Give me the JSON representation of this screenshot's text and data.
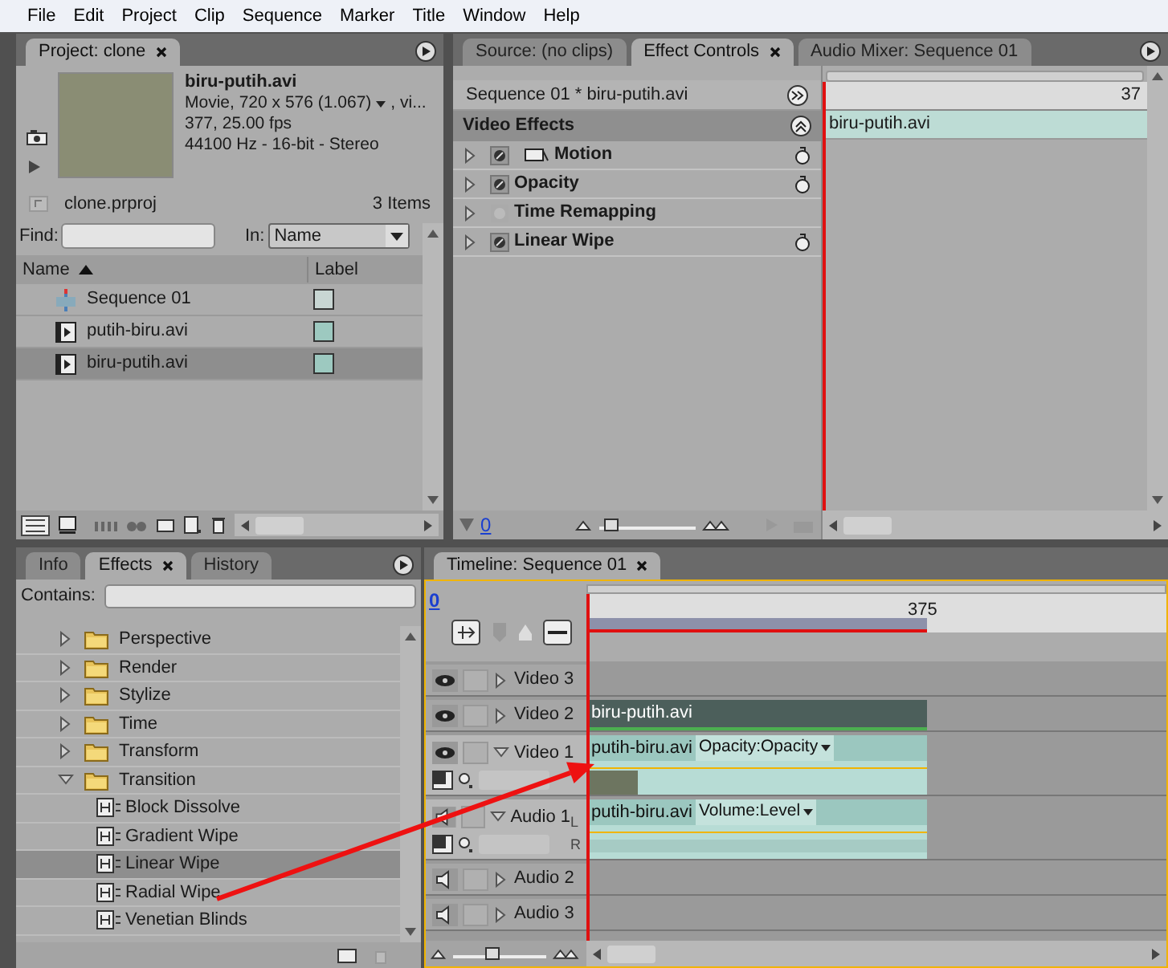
{
  "menu": [
    "File",
    "Edit",
    "Project",
    "Clip",
    "Sequence",
    "Marker",
    "Title",
    "Window",
    "Help"
  ],
  "project": {
    "tabs": [
      {
        "label": "Project: clone",
        "selected": true
      }
    ],
    "clip": {
      "name": "biru-putih.avi",
      "format": "Movie, 720 x 576 (1.067)",
      "format_more": ", vi...",
      "frames": "377, 25.00 fps",
      "audio": "44100 Hz - 16-bit - Stereo"
    },
    "file": "clone.prproj",
    "count": "3 Items",
    "find_label": "Find:",
    "in_label": "In:",
    "in_value": "Name",
    "columns": [
      "Name",
      "Label"
    ],
    "items": [
      {
        "name": "Sequence 01",
        "kind": "sequence",
        "color": "#c8d6d3",
        "selected": false
      },
      {
        "name": "putih-biru.avi",
        "kind": "clip",
        "color": "#9dc9c0",
        "selected": false
      },
      {
        "name": "biru-putih.avi",
        "kind": "clip",
        "color": "#9dc9c0",
        "selected": true
      }
    ]
  },
  "effect_controls": {
    "tabs": [
      {
        "label": "Source: (no clips)",
        "selected": false
      },
      {
        "label": "Effect Controls",
        "selected": true
      },
      {
        "label": "Audio Mixer: Sequence 01",
        "selected": false
      }
    ],
    "header": "Sequence 01 * biru-putih.avi",
    "section": "Video Effects",
    "effects": [
      {
        "name": "Motion",
        "toggle_enabled": true,
        "transform_icon": true,
        "reset": true
      },
      {
        "name": "Opacity",
        "toggle_enabled": true,
        "transform_icon": false,
        "reset": true
      },
      {
        "name": "Time Remapping",
        "toggle_enabled": false,
        "transform_icon": false,
        "reset": false
      },
      {
        "name": "Linear Wipe",
        "toggle_enabled": true,
        "transform_icon": false,
        "reset": true
      }
    ],
    "ruler_label": "37",
    "clip": "biru-putih.avi",
    "time": "0",
    "zoom": {
      "level": 0.05
    }
  },
  "effects_panel": {
    "tabs": [
      {
        "label": "Info",
        "selected": false
      },
      {
        "label": "Effects",
        "selected": true
      },
      {
        "label": "History",
        "selected": false
      }
    ],
    "contains_label": "Contains:",
    "tree": [
      {
        "name": "Perspective",
        "expanded": false
      },
      {
        "name": "Render",
        "expanded": false
      },
      {
        "name": "Stylize",
        "expanded": false
      },
      {
        "name": "Time",
        "expanded": false
      },
      {
        "name": "Transform",
        "expanded": false
      },
      {
        "name": "Transition",
        "expanded": true,
        "children": [
          {
            "name": "Block Dissolve",
            "selected": false
          },
          {
            "name": "Gradient Wipe",
            "selected": false
          },
          {
            "name": "Linear Wipe",
            "selected": true
          },
          {
            "name": "Radial Wipe",
            "selected": false
          },
          {
            "name": "Venetian Blinds",
            "selected": false
          }
        ]
      }
    ]
  },
  "timeline": {
    "tabs": [
      {
        "label": "Timeline: Sequence 01",
        "selected": true
      }
    ],
    "time": "0",
    "ruler_label": "375",
    "zoom": {
      "level": 0.4
    },
    "tracks": [
      {
        "name": "Video 3",
        "kind": "video",
        "expanded": false
      },
      {
        "name": "Video 2",
        "kind": "video",
        "expanded": false,
        "clip": {
          "name": "biru-putih.avi",
          "selected": true
        }
      },
      {
        "name": "Video 1",
        "kind": "video",
        "expanded": true,
        "clip": {
          "name": "putih-biru.avi",
          "selected": false,
          "property": "Opacity:Opacity"
        }
      },
      {
        "name": "Audio 1",
        "kind": "audio",
        "expanded": true,
        "channels": [
          "L",
          "R"
        ],
        "clip": {
          "name": "putih-biru.avi",
          "selected": false,
          "property": "Volume:Level"
        }
      },
      {
        "name": "Audio 2",
        "kind": "audio",
        "expanded": false
      },
      {
        "name": "Audio 3",
        "kind": "audio",
        "expanded": false
      }
    ]
  }
}
